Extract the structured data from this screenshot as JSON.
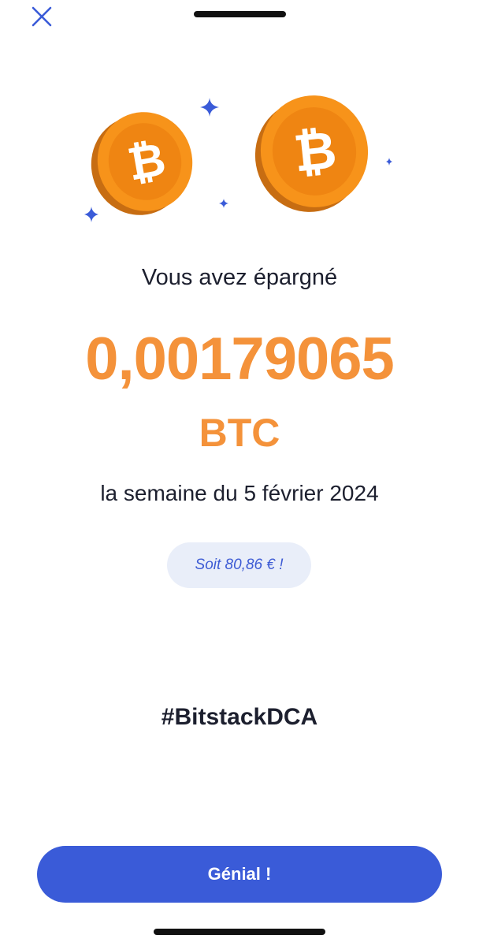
{
  "sheet": {
    "close_icon": "close-icon",
    "headline": "Vous avez épargné",
    "amount": "0,00179065",
    "currency": "BTC",
    "period": "la semaine du 5 février 2024",
    "fiat_equivalent": "Soit 80,86 € !",
    "hashtag": "#BitstackDCA",
    "cta_label": "Génial !"
  },
  "illustration": {
    "coin_icon": "bitcoin-coin-icon",
    "sparkle_icon": "sparkle-icon"
  },
  "colors": {
    "accent_orange": "#f4923a",
    "primary_blue": "#3a5bd8",
    "pill_background": "#e9eef9",
    "text_dark": "#1c1f2e"
  }
}
